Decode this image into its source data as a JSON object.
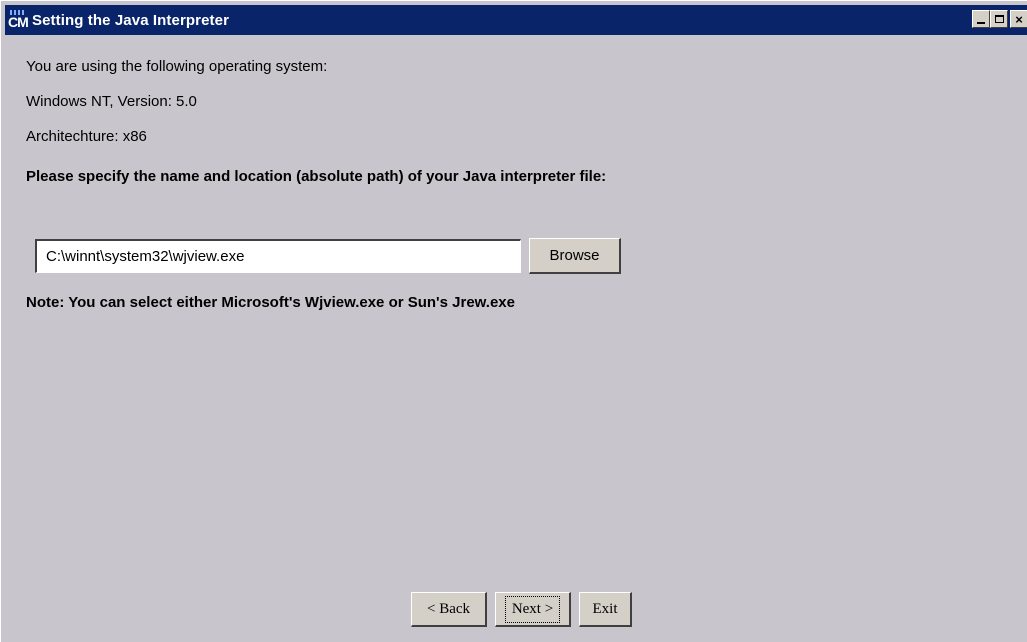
{
  "window": {
    "title": "Setting the Java Interpreter",
    "icon": "cm-app-icon",
    "controls": {
      "minimize": "_",
      "maximize": "□",
      "close": "×"
    }
  },
  "content": {
    "os_intro": "You are using the following operating system:",
    "os_version": "Windows NT, Version: 5.0",
    "architecture": "Architechture: x86",
    "prompt": "Please specify the name and location (absolute path) of your Java interpreter file:",
    "path_value": "C:\\winnt\\system32\\wjview.exe",
    "browse_label": "Browse",
    "note": "Note: You can select either Microsoft's Wjview.exe or Sun's Jrew.exe"
  },
  "footer": {
    "back_label": "< Back",
    "next_label": "Next >",
    "exit_label": "Exit"
  },
  "colors": {
    "titlebar": "#0a246a",
    "background": "#c8c5cc",
    "button_face": "#d4d0c8"
  }
}
